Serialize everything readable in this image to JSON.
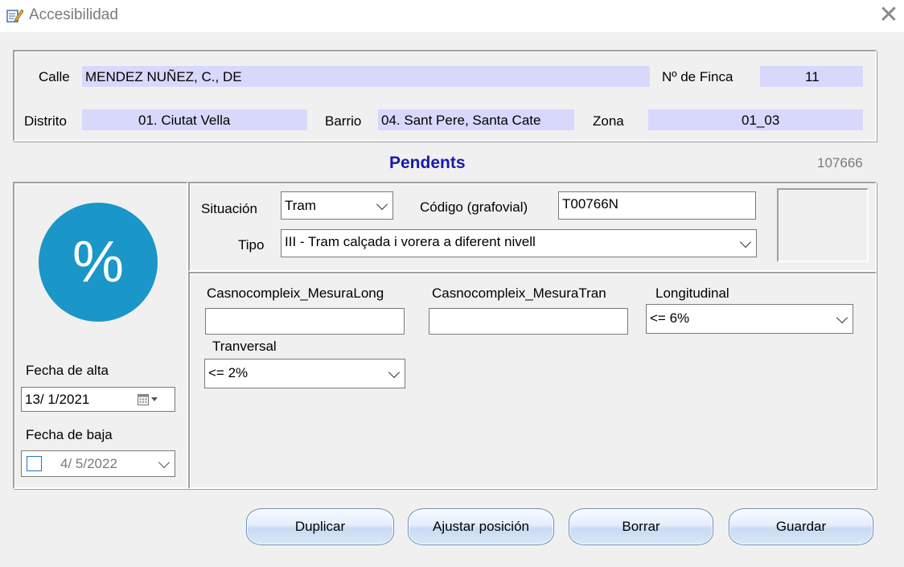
{
  "window": {
    "title": "Accesibilidad",
    "close_symbol": "✕"
  },
  "header": {
    "calle_label": "Calle",
    "calle_value": "MENDEZ NUÑEZ, C., DE",
    "finca_label": "Nº de Finca",
    "finca_value": "11",
    "distrito_label": "Distrito",
    "distrito_value": "01. Ciutat Vella",
    "barrio_label": "Barrio",
    "barrio_value": "04. Sant Pere, Santa Cate",
    "zona_label": "Zona",
    "zona_value": "01_03"
  },
  "section": {
    "title": "Pendents",
    "record_id": "107666",
    "title_color": "#1a1aa8"
  },
  "left_panel": {
    "icon_symbol": "%",
    "icon_color": "#1a96c8",
    "fecha_alta_label": "Fecha de alta",
    "fecha_alta_value": "13/ 1/2021",
    "fecha_baja_label": "Fecha de baja",
    "fecha_baja_value": "4/ 5/2022",
    "fecha_baja_checked": false
  },
  "form": {
    "situacion_label": "Situación",
    "situacion_value": "Tram",
    "codigo_label": "Código (grafovial)",
    "codigo_value": "T00766N",
    "tipo_label": "Tipo",
    "tipo_value": "III - Tram calçada i vorera a diferent nivell",
    "mesura_long_label": "Casnocompleix_MesuraLong",
    "mesura_long_value": "",
    "mesura_tran_label": "Casnocompleix_MesuraTran",
    "mesura_tran_value": "",
    "longitudinal_label": "Longitudinal",
    "longitudinal_value": "<= 6%",
    "tranversal_label": "Tranversal",
    "tranversal_value": "<= 2%"
  },
  "buttons": {
    "duplicar": "Duplicar",
    "ajustar": "Ajustar posición",
    "borrar": "Borrar",
    "guardar": "Guardar"
  }
}
